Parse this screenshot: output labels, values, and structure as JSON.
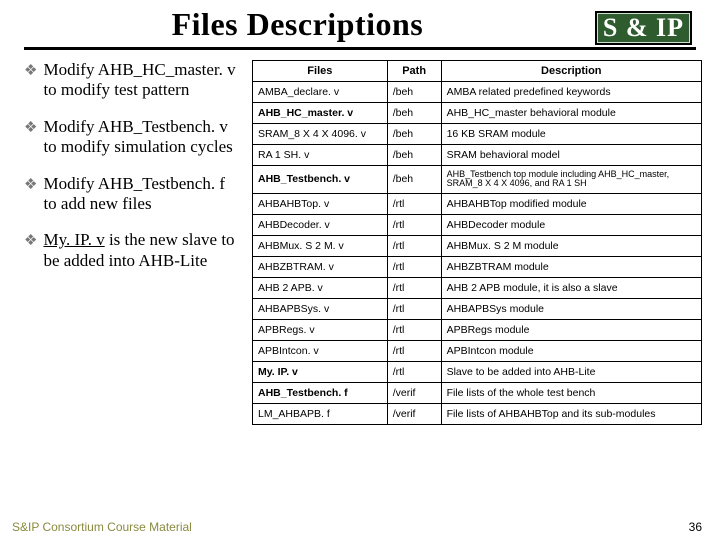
{
  "header": {
    "title": "Files Descriptions",
    "logo_text": "S & IP"
  },
  "bullets": [
    {
      "pre": "Modify ",
      "key": "AHB_HC_master. v",
      "post": " to modify test pattern",
      "underline": false
    },
    {
      "pre": "Modify ",
      "key": "AHB_Testbench. v",
      "post": " to modify simulation cycles",
      "underline": false
    },
    {
      "pre": "Modify ",
      "key": "AHB_Testbench. f",
      "post": " to add new files",
      "underline": false
    },
    {
      "pre": "",
      "key": "My. IP. v",
      "post": " is the new slave to be added into AHB-Lite",
      "underline": true
    }
  ],
  "table": {
    "headers": {
      "files": "Files",
      "path": "Path",
      "desc": "Description"
    },
    "rows": [
      {
        "file": "AMBA_declare. v",
        "file_bold": false,
        "path": "/beh",
        "desc": "AMBA related predefined keywords",
        "tiny": false
      },
      {
        "file": "AHB_HC_master. v",
        "file_bold": true,
        "path": "/beh",
        "desc": "AHB_HC_master behavioral module",
        "tiny": false
      },
      {
        "file": "SRAM_8 X 4 X 4096. v",
        "file_bold": false,
        "path": "/beh",
        "desc": "16 KB SRAM module",
        "tiny": false
      },
      {
        "file": "RA 1 SH. v",
        "file_bold": false,
        "path": "/beh",
        "desc": "SRAM behavioral model",
        "tiny": false
      },
      {
        "file": "AHB_Testbench. v",
        "file_bold": true,
        "path": "/beh",
        "desc": "AHB_Testbench top module including AHB_HC_master, SRAM_8 X 4 X 4096, and RA 1 SH",
        "tiny": true
      },
      {
        "file": "AHBAHBTop. v",
        "file_bold": false,
        "path": "/rtl",
        "desc": "AHBAHBTop modified module",
        "tiny": false
      },
      {
        "file": "AHBDecoder. v",
        "file_bold": false,
        "path": "/rtl",
        "desc": "AHBDecoder module",
        "tiny": false
      },
      {
        "file": "AHBMux. S 2 M. v",
        "file_bold": false,
        "path": "/rtl",
        "desc": "AHBMux. S 2 M module",
        "tiny": false
      },
      {
        "file": "AHBZBTRAM. v",
        "file_bold": false,
        "path": "/rtl",
        "desc": "AHBZBTRAM module",
        "tiny": false
      },
      {
        "file": "AHB 2 APB. v",
        "file_bold": false,
        "path": "/rtl",
        "desc": "AHB 2 APB module, it is also a slave",
        "tiny": false
      },
      {
        "file": "AHBAPBSys. v",
        "file_bold": false,
        "path": "/rtl",
        "desc": "AHBAPBSys module",
        "tiny": false
      },
      {
        "file": "APBRegs. v",
        "file_bold": false,
        "path": "/rtl",
        "desc": "APBRegs module",
        "tiny": false
      },
      {
        "file": "APBIntcon. v",
        "file_bold": false,
        "path": "/rtl",
        "desc": "APBIntcon module",
        "tiny": false
      },
      {
        "file": "My. IP. v",
        "file_bold": true,
        "path": "/rtl",
        "desc": "Slave to be added into AHB-Lite",
        "tiny": false
      },
      {
        "file": "AHB_Testbench. f",
        "file_bold": true,
        "path": "/verif",
        "desc": "File lists of the whole test bench",
        "tiny": false
      },
      {
        "file": "LM_AHBAPB. f",
        "file_bold": false,
        "path": "/verif",
        "desc": "File lists of AHBAHBTop and its sub-modules",
        "tiny": false
      }
    ]
  },
  "footer": {
    "credit": "S&IP Consortium Course Material",
    "page": "36"
  }
}
